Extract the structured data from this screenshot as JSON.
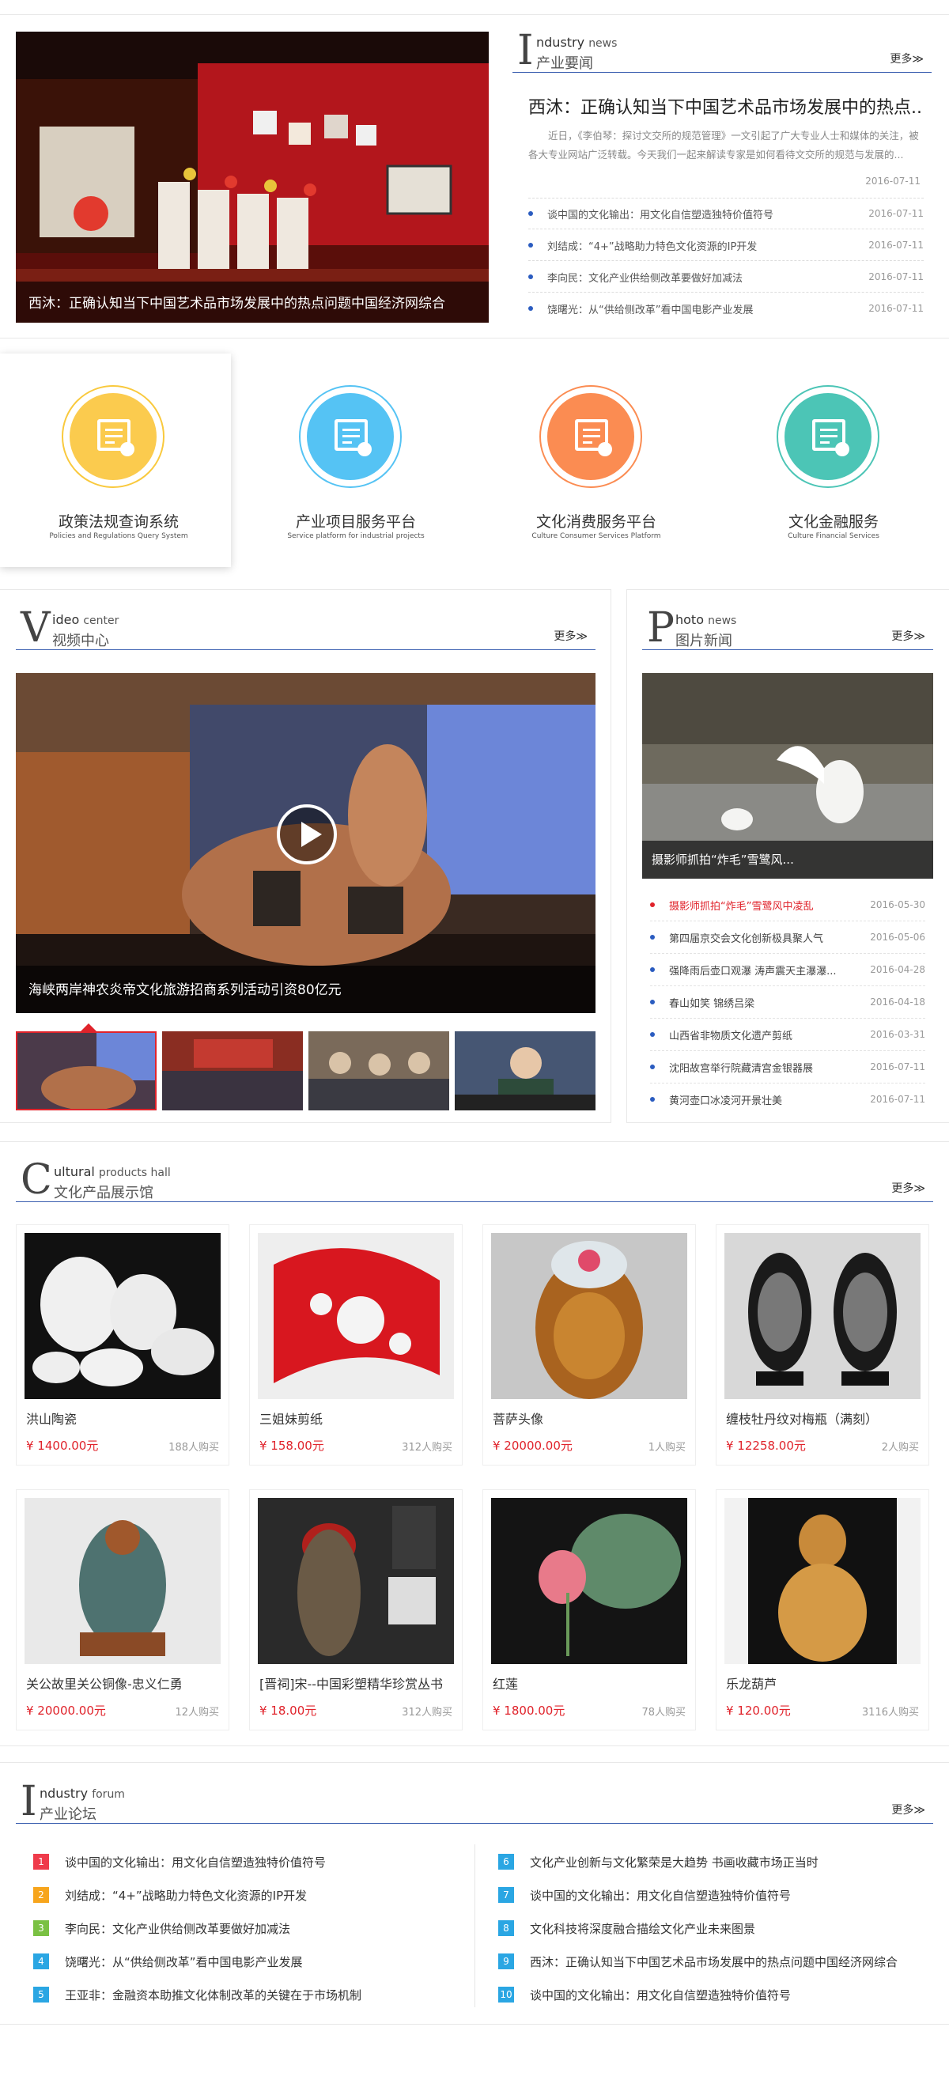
{
  "industry_news": {
    "big_letter": "I",
    "en_rest": "ndustry",
    "en_small": "news",
    "cn": "产业要闻",
    "more": "更多≫",
    "hero_caption": "西沐：正确认知当下中国艺术品市场发展中的热点问题中国经济网综合",
    "headline": "西沐：正确认知当下中国艺术品市场发展中的热点...",
    "summary": "近日，《李伯琴：探讨文交所的规范管理》一文引起了广大专业人士和媒体的关注，被各大专业网站广泛转载。今天我们一起来解读专家是如何看待文交所的规范与发展的...",
    "summary_date": "2016-07-11",
    "items": [
      {
        "title": "谈中国的文化输出：用文化自信塑造独特价值符号",
        "date": "2016-07-11"
      },
      {
        "title": "刘结成：“4+”战略助力特色文化资源的IP开发",
        "date": "2016-07-11"
      },
      {
        "title": "李向民：文化产业供给侧改革要做好加减法",
        "date": "2016-07-11"
      },
      {
        "title": "饶曙光：从“供给侧改革”看中国电影产业发展",
        "date": "2016-07-11"
      }
    ]
  },
  "services": [
    {
      "cn": "政策法规查询系统",
      "en": "Policies and Regulations Query System",
      "color": "#fbcb4e",
      "ring": "#f9c93d"
    },
    {
      "cn": "产业项目服务平台",
      "en": "Service platform for industrial projects",
      "color": "#55c3f4",
      "ring": "#55c3f4"
    },
    {
      "cn": "文化消费服务平台",
      "en": "Culture Consumer Services Platform",
      "color": "#fb8c52",
      "ring": "#fb8c52"
    },
    {
      "cn": "文化金融服务",
      "en": "Culture Financial Services",
      "color": "#4cc5b6",
      "ring": "#4cc5b6"
    }
  ],
  "video": {
    "big_letter": "V",
    "en_rest": "ideo",
    "en_small": "center",
    "cn": "视频中心",
    "more": "更多≫",
    "caption": "海峡两岸神农炎帝文化旅游招商系列活动引资80亿元"
  },
  "photo": {
    "big_letter": "P",
    "en_rest": "hoto",
    "en_small": "news",
    "cn": "图片新闻",
    "more": "更多≫",
    "caption": "摄影师抓拍“炸毛”雪鹭风...",
    "items": [
      {
        "title": "摄影师抓拍“炸毛”雪鹭风中凌乱",
        "date": "2016-05-30",
        "highlight": true
      },
      {
        "title": "第四届京交会文化创新极具聚人气",
        "date": "2016-05-06"
      },
      {
        "title": "强降雨后壶口观瀑 涛声震天主瀑瀑...",
        "date": "2016-04-28"
      },
      {
        "title": "春山如笑 锦绣吕梁",
        "date": "2016-04-18"
      },
      {
        "title": "山西省非物质文化遗产剪纸",
        "date": "2016-03-31"
      },
      {
        "title": "沈阳故宫举行院藏清宫金银器展",
        "date": "2016-07-11"
      },
      {
        "title": "黄河壶口冰凌河开景壮美",
        "date": "2016-07-11"
      }
    ]
  },
  "products": {
    "big_letter": "C",
    "en_rest": "ultural",
    "en_small": "products hall",
    "cn": "文化产品展示馆",
    "more": "更多≫",
    "items": [
      {
        "name": "洪山陶瓷",
        "price": "¥ 1400.00元",
        "buyers": "188人购买"
      },
      {
        "name": "三姐妹剪纸",
        "price": "¥ 158.00元",
        "buyers": "312人购买"
      },
      {
        "name": "菩萨头像",
        "price": "¥ 20000.00元",
        "buyers": "1人购买"
      },
      {
        "name": "缠枝牡丹纹对梅瓶（满刻）",
        "price": "¥ 12258.00元",
        "buyers": "2人购买"
      },
      {
        "name": "关公故里关公铜像-忠义仁勇",
        "price": "¥ 20000.00元",
        "buyers": "12人购买"
      },
      {
        "name": "[晋祠]宋--中国彩塑精华珍赏丛书",
        "price": "¥ 18.00元",
        "buyers": "312人购买"
      },
      {
        "name": "红莲",
        "price": "¥ 1800.00元",
        "buyers": "78人购买"
      },
      {
        "name": "乐龙葫芦",
        "price": "¥ 120.00元",
        "buyers": "3116人购买"
      }
    ]
  },
  "forum": {
    "big_letter": "I",
    "en_rest": "ndustry",
    "en_small": "forum",
    "cn": "产业论坛",
    "more": "更多≫",
    "items": [
      {
        "num": "1",
        "title": "谈中国的文化输出：用文化自信塑造独特价值符号",
        "color": "#ef3b4b"
      },
      {
        "num": "2",
        "title": "刘结成：“4+”战略助力特色文化资源的IP开发",
        "color": "#f7a51c"
      },
      {
        "num": "3",
        "title": "李向民：文化产业供给侧改革要做好加减法",
        "color": "#7ac143"
      },
      {
        "num": "4",
        "title": "饶曙光：从“供给侧改革”看中国电影产业发展",
        "color": "#2aa6e3"
      },
      {
        "num": "5",
        "title": "王亚非：金融资本助推文化体制改革的关键在于市场机制",
        "color": "#2aa6e3"
      },
      {
        "num": "6",
        "title": "文化产业创新与文化繁荣是大趋势 书画收藏市场正当时",
        "color": "#2aa6e3"
      },
      {
        "num": "7",
        "title": "谈中国的文化输出：用文化自信塑造独特价值符号",
        "color": "#2aa6e3"
      },
      {
        "num": "8",
        "title": "文化科技将深度融合描绘文化产业未来图景",
        "color": "#2aa6e3"
      },
      {
        "num": "9",
        "title": "西沐：正确认知当下中国艺术品市场发展中的热点问题中国经济网综合",
        "color": "#2aa6e3"
      },
      {
        "num": "10",
        "title": "谈中国的文化输出：用文化自信塑造独特价值符号",
        "color": "#2aa6e3"
      }
    ]
  }
}
